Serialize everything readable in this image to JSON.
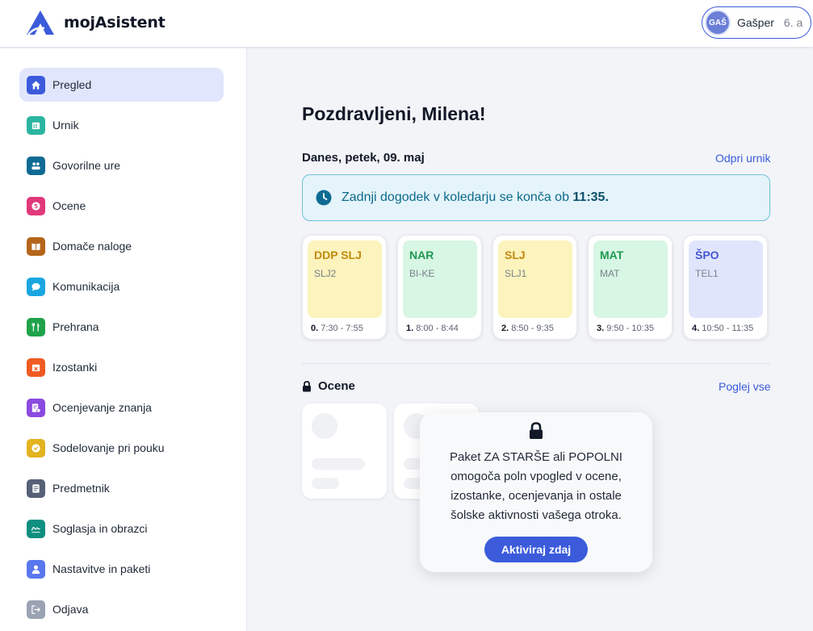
{
  "app": {
    "name": "mojAsistent"
  },
  "user": {
    "initials": "GAŠ",
    "name": "Gašper",
    "class": "6. a"
  },
  "colors": {
    "accent": "#3b5bdb",
    "active_nav_bg": "#e1e6fd"
  },
  "sidebar": {
    "items": [
      {
        "label": "Pregled",
        "icon": "home-icon",
        "color": "#3b5bdb",
        "active": true
      },
      {
        "label": "Urnik",
        "icon": "calendar-icon",
        "color": "#2bb5a0",
        "active": false
      },
      {
        "label": "Govorilne ure",
        "icon": "people-icon",
        "color": "#0f6b93",
        "active": false
      },
      {
        "label": "Ocene",
        "icon": "grade-icon",
        "color": "#e0387a",
        "active": false
      },
      {
        "label": "Domače naloge",
        "icon": "book-icon",
        "color": "#b4651a",
        "active": false
      },
      {
        "label": "Komunikacija",
        "icon": "chat-icon",
        "color": "#1aa6e0",
        "active": false
      },
      {
        "label": "Prehrana",
        "icon": "cutlery-icon",
        "color": "#1fa34a",
        "active": false
      },
      {
        "label": "Izostanki",
        "icon": "calendar-x-icon",
        "color": "#ef5b22",
        "active": false
      },
      {
        "label": "Ocenjevanje znanja",
        "icon": "exam-icon",
        "color": "#8a4ae0",
        "active": false
      },
      {
        "label": "Sodelovanje pri pouku",
        "icon": "check-badge-icon",
        "color": "#e3b320",
        "active": false
      },
      {
        "label": "Predmetnik",
        "icon": "list-book-icon",
        "color": "#566177",
        "active": false
      },
      {
        "label": "Soglasja in obrazci",
        "icon": "signature-icon",
        "color": "#0f8f80",
        "active": false
      },
      {
        "label": "Nastavitve in paketi",
        "icon": "user-icon",
        "color": "#5978ee",
        "active": false
      },
      {
        "label": "Odjava",
        "icon": "logout-icon",
        "color": "#9aa3b3",
        "active": false
      }
    ]
  },
  "main": {
    "greeting": "Pozdravljeni, Milena!",
    "date_title": "Danes, petek, 09. maj",
    "open_schedule_link": "Odpri urnik",
    "banner": {
      "text": "Zadnji dogodek v koledarju se konča ob ",
      "time": "11:35."
    },
    "lessons": [
      {
        "subject": "DDP SLJ",
        "code": "SLJ2",
        "number": "0.",
        "time": "7:30 - 7:55",
        "bg": "#fcf3bd",
        "fg": "#c28a0e"
      },
      {
        "subject": "NAR",
        "code": "BI-KE",
        "number": "1.",
        "time": "8:00 - 8:44",
        "bg": "#d8f6e4",
        "fg": "#1f9a52"
      },
      {
        "subject": "SLJ",
        "code": "SLJ1",
        "number": "2.",
        "time": "8:50 - 9:35",
        "bg": "#fcf3bd",
        "fg": "#c28a0e"
      },
      {
        "subject": "MAT",
        "code": "MAT",
        "number": "3.",
        "time": "9:50 - 10:35",
        "bg": "#d8f6e4",
        "fg": "#1f9a52"
      },
      {
        "subject": "ŠPO",
        "code": "TEL1",
        "number": "4.",
        "time": "10:50 - 11:35",
        "bg": "#e1e5fc",
        "fg": "#4456d0"
      }
    ],
    "grades_section": {
      "title": "Ocene",
      "view_all_link": "Poglej vse",
      "locked_message": "Paket ZA STARŠE ali POPOLNI omogoča poln vpogled v ocene, izostanke, ocenjevanja in ostale šolske aktivnosti vašega otroka.",
      "cta": "Aktiviraj zdaj"
    }
  }
}
